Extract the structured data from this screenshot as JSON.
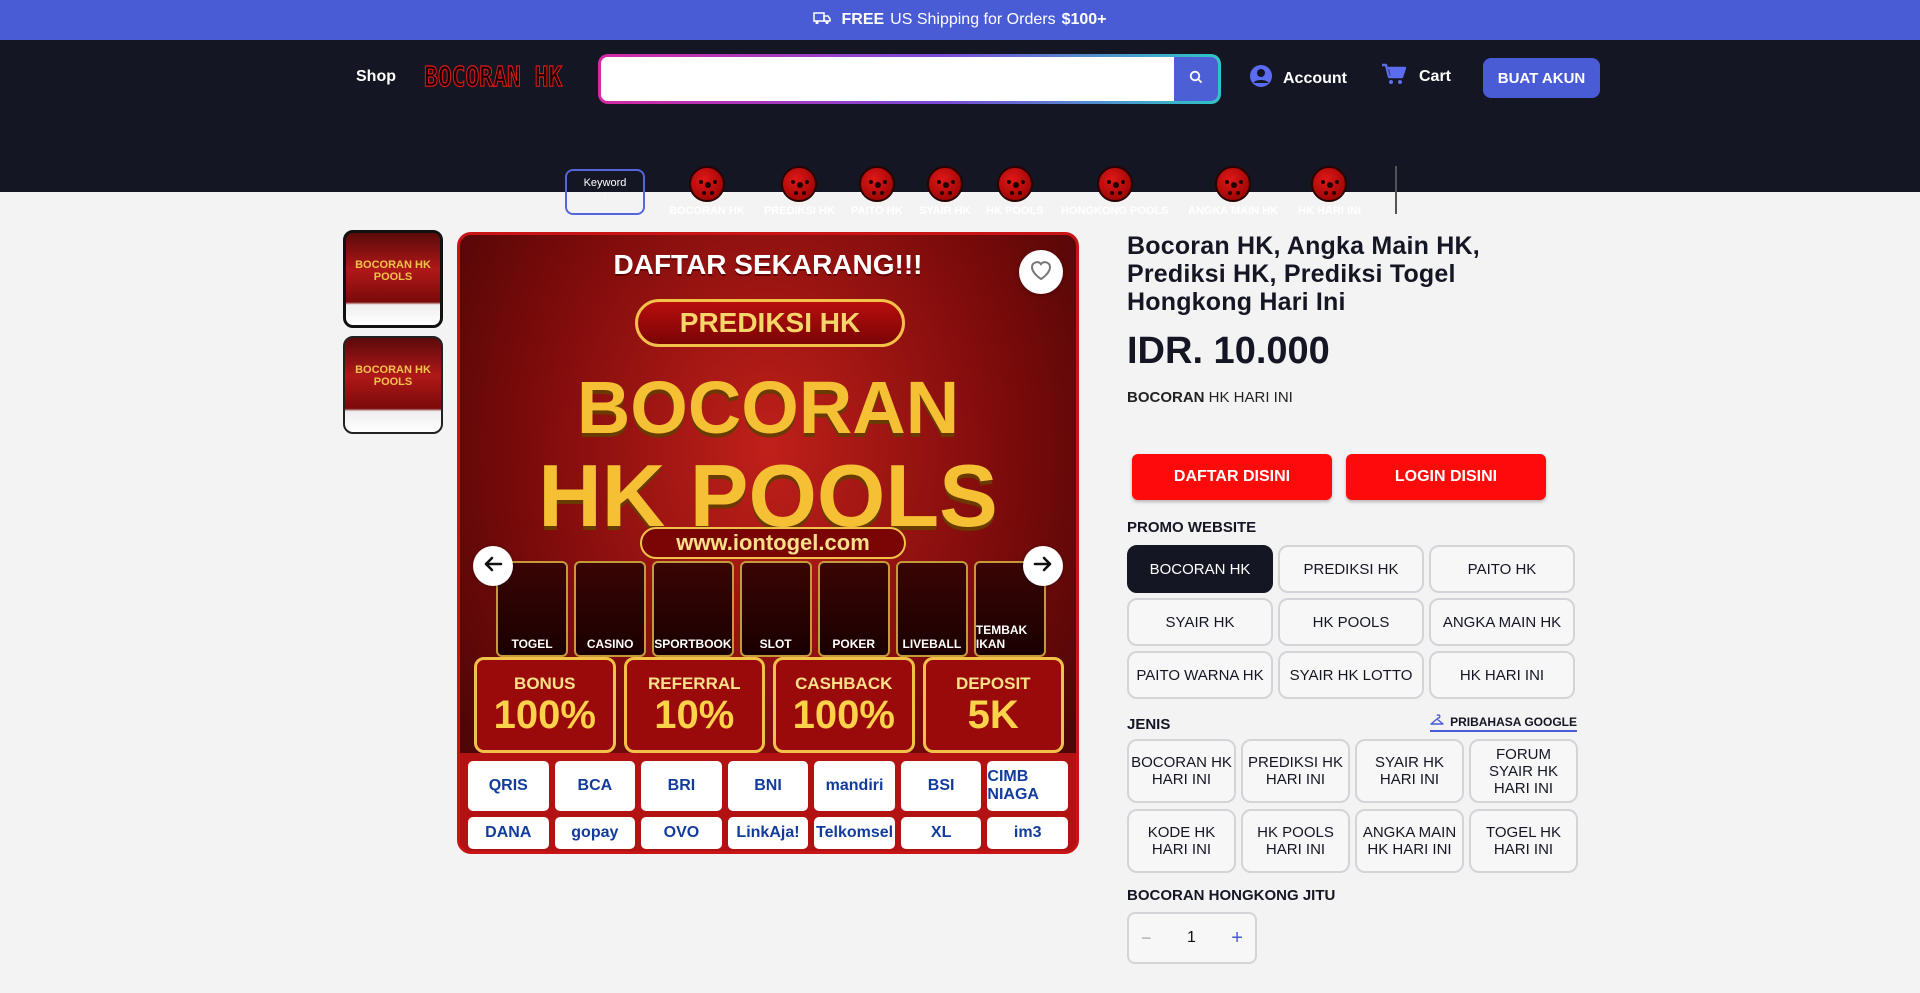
{
  "announcement": {
    "free": "FREE",
    "text": "US Shipping for Orders",
    "amount": "$100+"
  },
  "header": {
    "shop": "Shop",
    "logo": "BOCORAN HK",
    "search_placeholder": "",
    "account": "Account",
    "cart": "Cart",
    "create_account": "BUAT AKUN"
  },
  "categories": {
    "keyword_line1": "Keyword",
    "keyword_line2": ":",
    "items": [
      "BOCORAN HK",
      "PREDIKSI HK",
      "PAITO HK",
      "SYAIR HK",
      "HK POOLS",
      "HONGKONG POOLS",
      "ANGKA MAIN HK",
      "HK HARI INI"
    ]
  },
  "banner": {
    "headline": "DAFTAR SEKARANG!!!",
    "badge": "PREDIKSI HK",
    "big1": "BOCORAN",
    "big2": "HK POOLS",
    "url": "www.iontogel.com",
    "games": [
      "TOGEL",
      "CASINO",
      "SPORTBOOK",
      "SLOT",
      "POKER",
      "LIVEBALL",
      "TEMBAK IKAN"
    ],
    "promos": [
      {
        "label": "BONUS",
        "value": "100%"
      },
      {
        "label": "REFERRAL",
        "value": "10%"
      },
      {
        "label": "CASHBACK",
        "value": "100%"
      },
      {
        "label": "DEPOSIT",
        "value": "5K"
      }
    ],
    "payments": [
      "QRIS",
      "BCA",
      "BRI",
      "BNI",
      "mandiri",
      "BSI",
      "CIMB NIAGA",
      "DANA",
      "gopay",
      "OVO",
      "LinkAja!",
      "Telkomsel",
      "XL",
      "im3"
    ]
  },
  "product": {
    "title": "Bocoran HK, Angka Main HK, Prediksi HK, Prediksi Togel Hongkong Hari Ini",
    "price": "IDR. 10.000",
    "sub_bold": "BOCORAN",
    "sub_rest": "HK HARI INI",
    "register_btn": "DAFTAR DISINI",
    "login_btn": "LOGIN DISINI",
    "promo_label": "PROMO WEBSITE",
    "promo_options": [
      "BOCORAN HK",
      "PREDIKSI HK",
      "PAITO HK",
      "SYAIR HK",
      "HK POOLS",
      "ANGKA MAIN HK",
      "PAITO WARNA HK",
      "SYAIR HK LOTTO",
      "HK HARI INI"
    ],
    "jenis_label": "JENIS",
    "guide_link": "PRIBAHASA GOOGLE",
    "jenis_options": [
      "BOCORAN HK HARI INI",
      "PREDIKSI HK HARI INI",
      "SYAIR HK HARI INI",
      "FORUM SYAIR HK HARI INI",
      "KODE HK HARI INI",
      "HK POOLS HARI INI",
      "ANGKA MAIN HK HARI INI",
      "TOGEL HK HARI INI"
    ],
    "qty_label": "BOCORAN HONGKONG JITU",
    "qty_minus": "−",
    "qty_value": "1",
    "qty_plus": "+"
  },
  "colors": {
    "accent": "#4a5bd6",
    "header_bg": "#141623",
    "red": "#ff0a0a"
  }
}
